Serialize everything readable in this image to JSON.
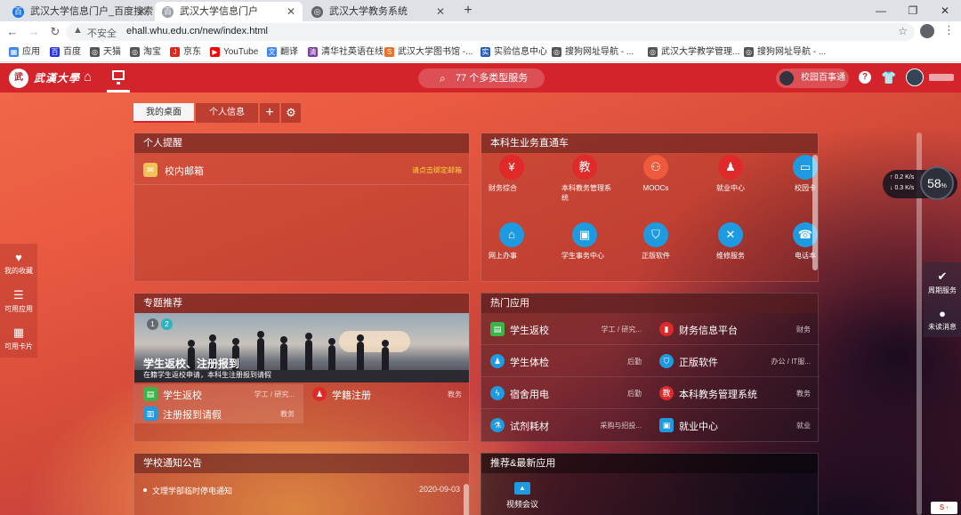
{
  "browser": {
    "tabs": [
      {
        "title": "武汉大学信息门户_百度搜索",
        "active": false
      },
      {
        "title": "武汉大学信息门户",
        "active": true
      },
      {
        "title": "武汉大学教务系统",
        "active": false
      }
    ],
    "address": {
      "security": "不安全",
      "url": "ehall.whu.edu.cn/new/index.html"
    },
    "bookmarks": [
      "应用",
      "百度",
      "天猫",
      "淘宝",
      "京东",
      "YouTube",
      "翻译",
      "清华社英语在线",
      "武汉大学图书馆 -...",
      "实验信息中心",
      "搜狗网址导航 - ...",
      "武汉大学教学管理...",
      "搜狗网址导航 - ..."
    ]
  },
  "portal": {
    "search_label": "77 个多类型服务",
    "campus_label": "校园百事通",
    "desk_tabs": [
      "我的桌面",
      "个人信息"
    ],
    "colors": {
      "nav_red": "#d3232b",
      "accent_yellow": "#ffd23f"
    }
  },
  "reminder": {
    "title": "个人提醒",
    "mail_label": "校内邮箱",
    "mail_bind": "请点击绑定邮箱"
  },
  "services": {
    "title": "本科生业务直通车",
    "items": [
      "财务综合",
      "本科教务管理系统",
      "MOOCs",
      "就业中心",
      "校园卡",
      "网上办事",
      "学生事务中心",
      "正版软件",
      "维修服务",
      "电话本"
    ]
  },
  "topics": {
    "title": "专题推荐",
    "pages": [
      "1",
      "2"
    ],
    "banner_title": "学生返校、注册报到",
    "banner_sub": "在籍学生返校申请，本科生注册报到请假",
    "items": [
      {
        "name": "学生返校",
        "cat": "学工 / 研究..."
      },
      {
        "name": "学籍注册",
        "cat": "教务"
      },
      {
        "name": "注册报到请假",
        "cat": "教务"
      }
    ]
  },
  "hot": {
    "title": "热门应用",
    "items": [
      {
        "name": "学生返校",
        "cat": "学工 / 研究..."
      },
      {
        "name": "财务信息平台",
        "cat": "财务"
      },
      {
        "name": "学生体检",
        "cat": "后勤"
      },
      {
        "name": "正版软件",
        "cat": "办公 / IT服..."
      },
      {
        "name": "宿舍用电",
        "cat": "后勤"
      },
      {
        "name": "本科教务管理系统",
        "cat": "教务"
      },
      {
        "name": "试剂耗材",
        "cat": "采购与招投..."
      },
      {
        "name": "就业中心",
        "cat": "就业"
      }
    ]
  },
  "notices": {
    "title": "学校通知公告",
    "items": [
      {
        "text": "文理学部临时停电通知",
        "date": "2020-09-03"
      }
    ]
  },
  "recommend": {
    "title": "推荐&最新应用",
    "item": "视频会议"
  },
  "leftbar": [
    "我的收藏",
    "可用应用",
    "可用卡片"
  ],
  "rightbar": [
    "周期服务",
    "未读消息"
  ],
  "net": {
    "up": "0.2",
    "down": "0.3",
    "unit": "K/s",
    "percent": "58",
    "percent_unit": "%"
  }
}
